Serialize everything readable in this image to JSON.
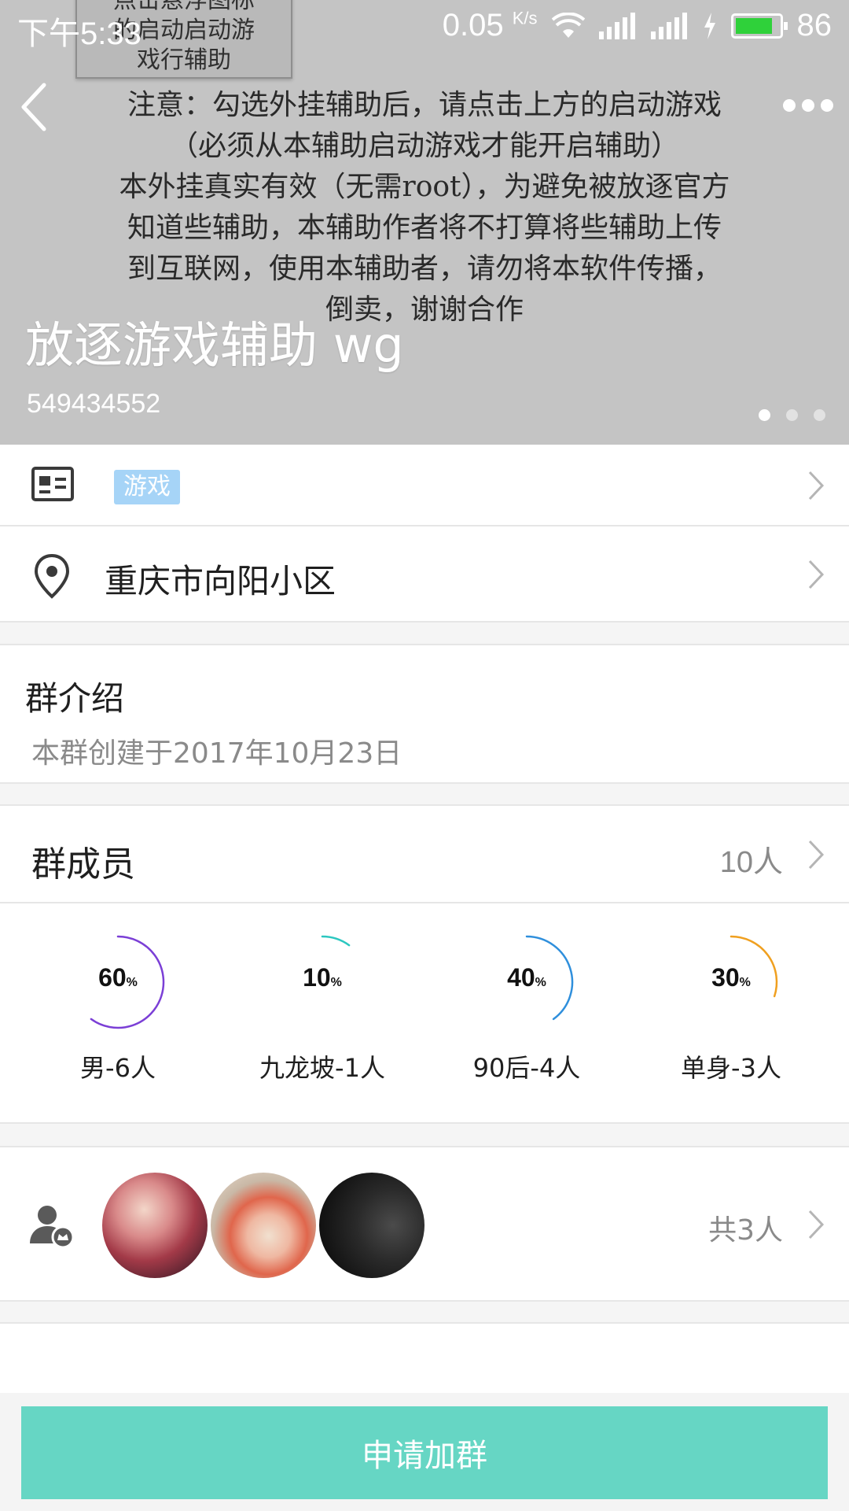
{
  "status_bar": {
    "time": "下午5:33",
    "net_speed": "0.05",
    "net_unit": "K/s",
    "battery": "86",
    "battery_level": 0.86
  },
  "banner": {
    "poster_lines": [
      "点击悬浮图标",
      "的启动启动游",
      "戏行辅助"
    ],
    "notice_lines": [
      "注意：勾选外挂辅助后，请点击上方的启动游戏",
      "（必须从本辅助启动游戏才能开启辅助）",
      "本外挂真实有效（无需root），为避免被放逐官方",
      "知道些辅助，本辅助作者将不打算将些辅助上传",
      "到互联网，使用本辅助者，请勿将本软件传播，",
      "倒卖，谢谢合作"
    ],
    "title": "放逐游戏辅助 wg",
    "group_id": "549434552",
    "page_count": 3,
    "active_page": 1
  },
  "tag_row": {
    "tag": "游戏",
    "icon": "id-card-icon"
  },
  "location_row": {
    "text": "重庆市向阳小区",
    "icon": "location-pin-icon"
  },
  "intro": {
    "heading": "群介绍",
    "text": "本群创建于2017年10月23日"
  },
  "members": {
    "heading": "群成员",
    "count": "10人"
  },
  "stats": [
    {
      "value": "60",
      "unit": "%",
      "label": "男-6人",
      "fraction": 0.6,
      "color": "#7b3fd6"
    },
    {
      "value": "10",
      "unit": "%",
      "label": "九龙坡-1人",
      "fraction": 0.1,
      "color": "#2cc7c0"
    },
    {
      "value": "40",
      "unit": "%",
      "label": "90后-4人",
      "fraction": 0.4,
      "color": "#2f8fdc"
    },
    {
      "value": "30",
      "unit": "%",
      "label": "单身-3人",
      "fraction": 0.3,
      "color": "#f0a020"
    }
  ],
  "admins": {
    "total": "共3人",
    "icon": "admin-user-icon"
  },
  "join_button": {
    "label": "申请加群"
  },
  "colors": {
    "accent": "#66d6c4",
    "tag_bg": "#a6d4f7"
  }
}
